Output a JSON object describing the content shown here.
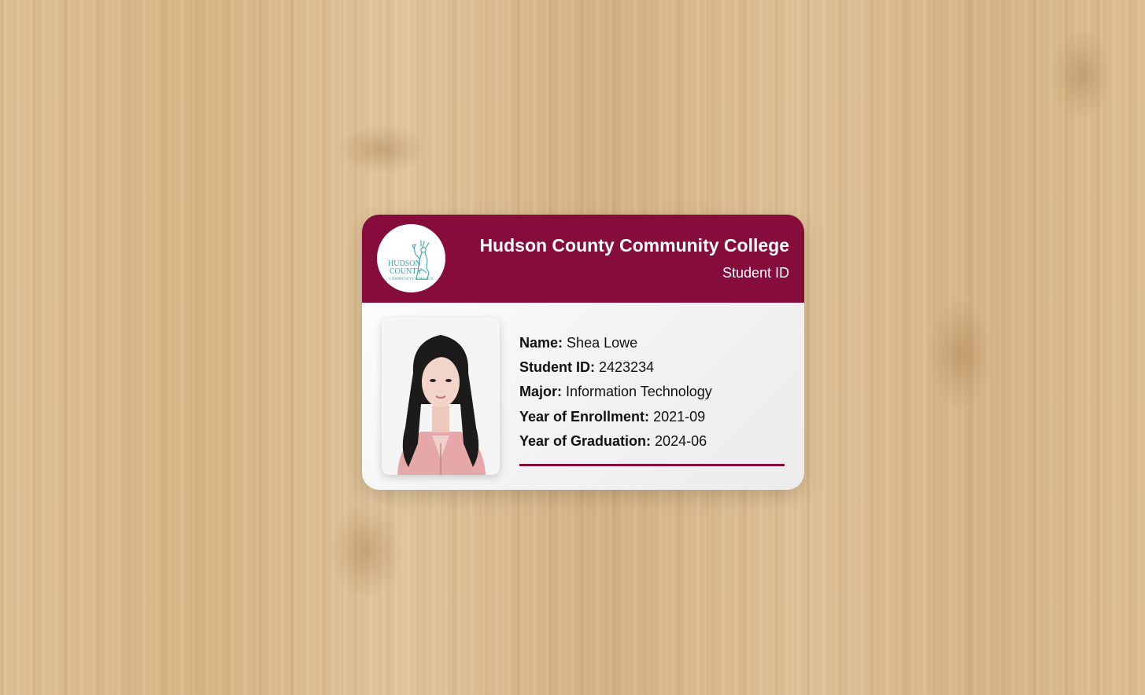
{
  "header": {
    "college_name": "Hudson County Community College",
    "card_type": "Student ID"
  },
  "logo": {
    "line1": "HUDSON",
    "line2": "COUNTY",
    "line3": "COMMUNITY COLLEGE",
    "color": "#3aa6ad"
  },
  "student": {
    "name_label": "Name:",
    "name": "Shea Lowe",
    "id_label": "Student ID:",
    "id": "2423234",
    "major_label": "Major:",
    "major": "Information Technology",
    "enrollment_label": "Year of Enrollment:",
    "enrollment": "2021-09",
    "graduation_label": "Year of Graduation:",
    "graduation": "2024-06"
  },
  "colors": {
    "brand": "#860c3c",
    "background_wood": "#d8b98c"
  },
  "icons": [
    "statue-of-liberty-logo-icon",
    "student-photo"
  ]
}
